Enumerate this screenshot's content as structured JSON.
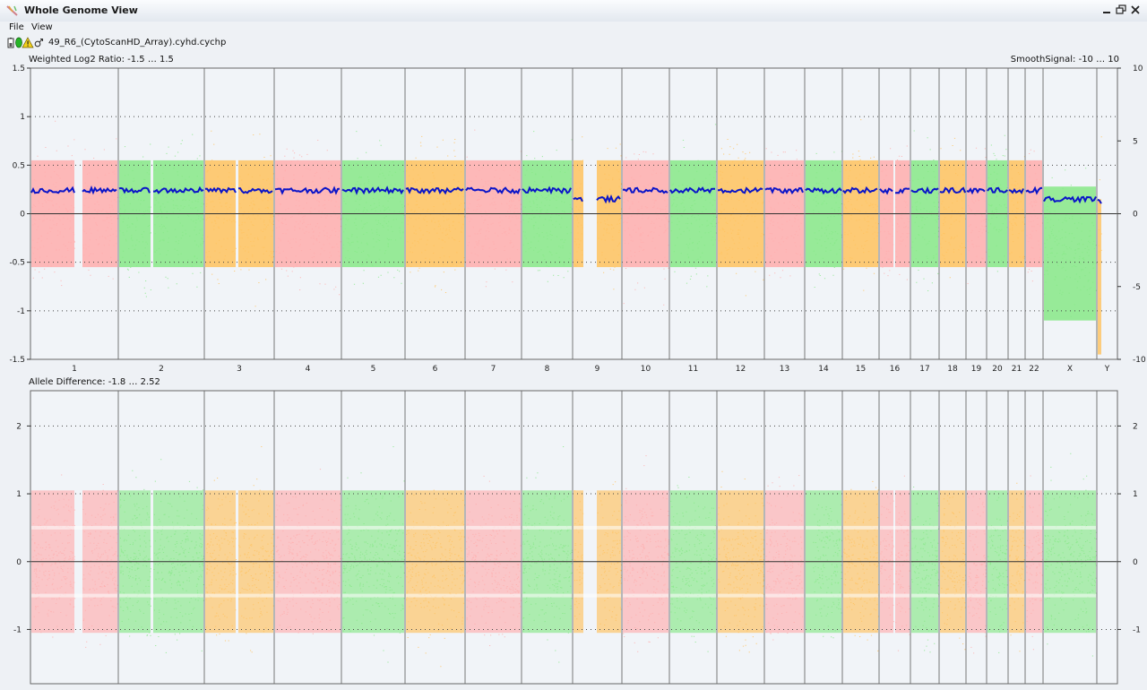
{
  "window": {
    "title": "Whole Genome View",
    "controls": [
      "minimize-icon",
      "restore-icon",
      "close-icon"
    ]
  },
  "menu": {
    "items": [
      "File",
      "View"
    ]
  },
  "file": {
    "name": "49_R6_(CytoScanHD_Array).cyhd.cychp",
    "status_icons": [
      "battery-icon",
      "green-status-icon",
      "warning-icon",
      "male-symbol-icon"
    ]
  },
  "colors": {
    "pink": "#ffadad",
    "green": "#87e887",
    "orange": "#ffc25e",
    "smooth_line": "#0a14c8",
    "plot_bg": "#f1f4f8",
    "divider": "#777777"
  },
  "log2_panel": {
    "label": "Weighted Log2 Ratio: -1.5 … 1.5",
    "right_label": "SmoothSignal: -10 … 10",
    "left_ticks": [
      "1.5",
      "1",
      "0.5",
      "0",
      "-0.5",
      "-1",
      "-1.5"
    ],
    "right_ticks": [
      "10",
      "5",
      "0",
      "-5",
      "-10"
    ],
    "ylim": [
      -1.5,
      1.5
    ],
    "smooth_ylim": [
      -10,
      10
    ]
  },
  "allele_panel": {
    "label": "Allele Difference: -1.8 … 2.52",
    "left_ticks": [
      "2",
      "1",
      "0",
      "-1"
    ],
    "right_ticks": [
      "2",
      "1",
      "0",
      "-1"
    ],
    "ylim": [
      -1.8,
      2.52
    ]
  },
  "chart_data": {
    "type": "scatter",
    "chromosomes": [
      "1",
      "2",
      "3",
      "4",
      "5",
      "6",
      "7",
      "8",
      "9",
      "10",
      "11",
      "12",
      "13",
      "14",
      "15",
      "16",
      "17",
      "18",
      "19",
      "20",
      "21",
      "22",
      "X",
      "Y"
    ],
    "color_order": [
      "pink",
      "green",
      "orange",
      "pink",
      "green",
      "orange",
      "pink",
      "green",
      "orange",
      "pink",
      "green",
      "orange",
      "pink",
      "green",
      "orange",
      "pink",
      "green",
      "orange",
      "pink",
      "green",
      "orange",
      "pink",
      "green",
      "orange"
    ],
    "smooth_signal_levels": [
      1.6,
      1.6,
      1.6,
      1.6,
      1.6,
      1.6,
      1.6,
      1.6,
      1.0,
      1.6,
      1.6,
      1.6,
      1.6,
      1.6,
      1.6,
      1.6,
      1.6,
      1.6,
      1.6,
      1.6,
      1.6,
      1.6,
      1.0,
      0.8
    ]
  }
}
